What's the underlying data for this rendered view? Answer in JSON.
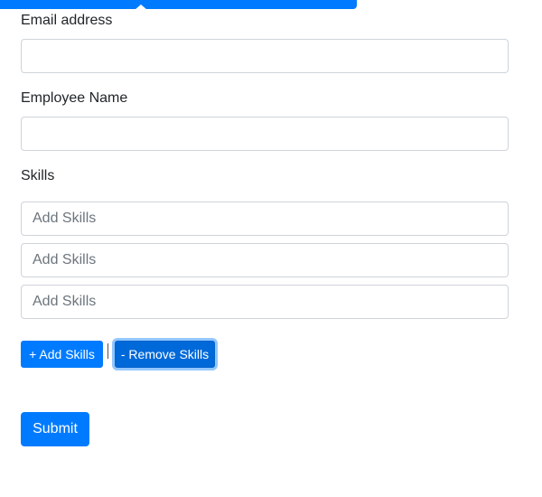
{
  "form": {
    "email_label": "Email address",
    "email_value": "",
    "employee_name_label": "Employee Name",
    "employee_name_value": "",
    "skills_label": "Skills",
    "skills": [
      {
        "value": "",
        "placeholder": "Add Skills"
      },
      {
        "value": "",
        "placeholder": "Add Skills"
      },
      {
        "value": "",
        "placeholder": "Add Skills"
      }
    ],
    "add_skills_label": "+ Add Skills",
    "remove_skills_label": "- Remove Skills",
    "submit_label": "Submit"
  },
  "colors": {
    "primary": "#007bff",
    "primary_active": "#0069d9",
    "input_border": "#ced4da",
    "placeholder": "#6c757d"
  }
}
